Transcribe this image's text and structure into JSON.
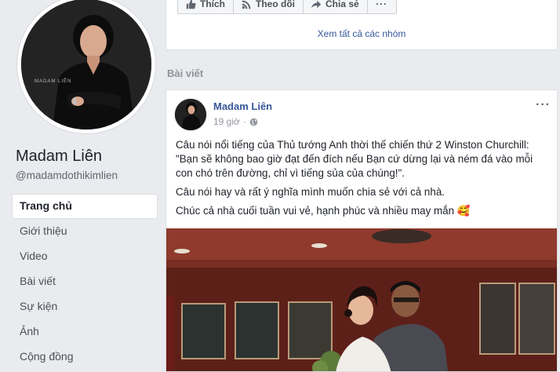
{
  "profile": {
    "name": "Madam Liên",
    "handle": "@madamdothikimlien",
    "photo_caption": "MADAM LIÊN"
  },
  "nav": {
    "items": [
      {
        "label": "Trang chủ",
        "active": true
      },
      {
        "label": "Giới thiệu"
      },
      {
        "label": "Video"
      },
      {
        "label": "Bài viết"
      },
      {
        "label": "Sự kiện"
      },
      {
        "label": "Ảnh"
      },
      {
        "label": "Cộng đồng"
      }
    ]
  },
  "actions": {
    "like": "Thích",
    "follow": "Theo dõi",
    "share": "Chia sẻ",
    "more": "···"
  },
  "groups": {
    "see_all": "Xem tất cả các nhóm"
  },
  "section": {
    "title": "Bài viết"
  },
  "post": {
    "author": "Madam Liên",
    "time": "19 giờ",
    "separator": "·",
    "paragraphs": [
      "Câu nói nổi tiếng của Thủ tướng Anh thời thế chiến thứ 2 Winston Churchill: \"Bạn sẽ không bao giờ đạt đến đích nếu Bạn cứ dừng lại và ném đá vào mỗi con chó trên đường, chỉ vì tiếng sủa của chúng!\".",
      "Câu nói hay và rất ý nghĩa mình muốn chia sẻ với cả nhà.",
      "Chúc cả nhà cuối tuần vui vẻ, hạnh phúc và nhiều may mắn 🥰"
    ]
  },
  "colors": {
    "link": "#365899",
    "background": "#e9ebee"
  }
}
